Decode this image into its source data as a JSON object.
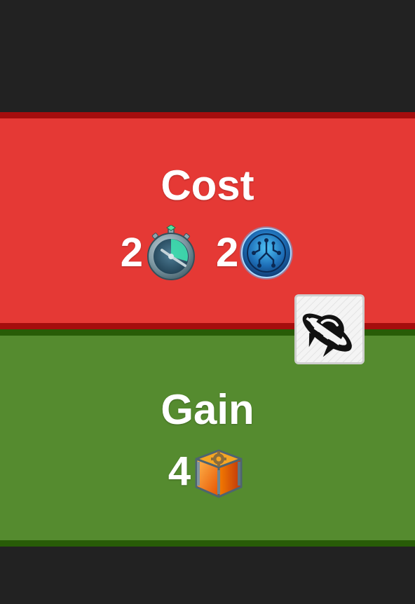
{
  "cost": {
    "title": "Cost",
    "items": [
      {
        "amount": "2",
        "icon": "stopwatch-time-icon"
      },
      {
        "amount": "2",
        "icon": "blue-tech-chip-icon"
      }
    ]
  },
  "gain": {
    "title": "Gain",
    "items": [
      {
        "amount": "4",
        "icon": "orange-gear-crate-icon"
      }
    ]
  },
  "badge": {
    "icon": "ufo-icon"
  },
  "colors": {
    "background": "#222222",
    "cost_band": "#e53935",
    "cost_border": "#a50d0d",
    "gain_band": "#558b2f",
    "gain_border": "#285c07",
    "text": "#ffffff"
  }
}
